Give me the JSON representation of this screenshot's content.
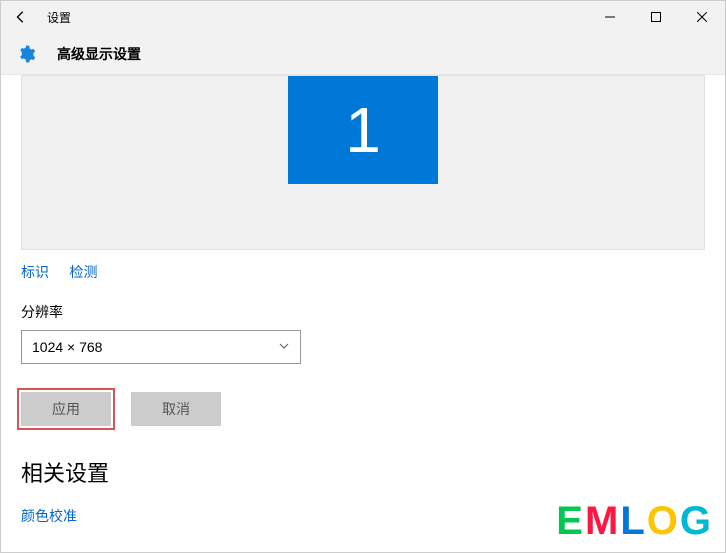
{
  "window": {
    "title": "设置",
    "controls": {
      "minimize": "–",
      "maximize": "□",
      "close": "✕"
    }
  },
  "header": {
    "title": "高级显示设置"
  },
  "monitor": {
    "id": "1"
  },
  "links": {
    "identify": "标识",
    "detect": "检测"
  },
  "resolution": {
    "label": "分辨率",
    "value": "1024 × 768"
  },
  "buttons": {
    "apply": "应用",
    "cancel": "取消"
  },
  "related": {
    "heading": "相关设置",
    "color_calibration": "颜色校准"
  },
  "watermark": [
    "E",
    "M",
    "L",
    "O",
    "G"
  ]
}
